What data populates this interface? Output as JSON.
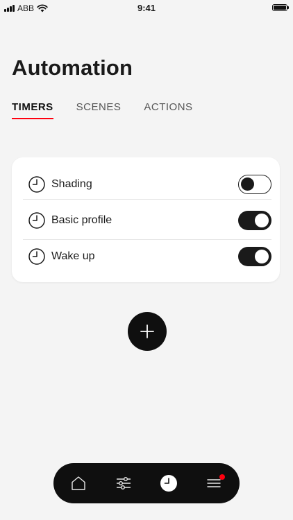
{
  "status_bar": {
    "carrier": "ABB",
    "time": "9:41",
    "battery_level": 1.0
  },
  "page": {
    "title": "Automation"
  },
  "tabs": [
    {
      "label": "TIMERS",
      "active": true
    },
    {
      "label": "SCENES",
      "active": false
    },
    {
      "label": "ACTIONS",
      "active": false
    }
  ],
  "timers": [
    {
      "name": "Shading",
      "icon": "clock-icon",
      "enabled": false
    },
    {
      "name": "Basic profile",
      "icon": "clock-icon",
      "enabled": true
    },
    {
      "name": "Wake up",
      "icon": "clock-icon",
      "enabled": true
    }
  ],
  "fab": {
    "icon": "plus-icon"
  },
  "bottom_nav": {
    "items": [
      {
        "icon": "home-icon",
        "active": false
      },
      {
        "icon": "sliders-icon",
        "active": false
      },
      {
        "icon": "clock-icon",
        "active": true
      },
      {
        "icon": "menu-icon",
        "active": false,
        "notification": true
      }
    ]
  },
  "colors": {
    "background": "#f4f4f4",
    "card": "#ffffff",
    "accent_red": "#ff000f",
    "dark": "#0f0f0f"
  }
}
